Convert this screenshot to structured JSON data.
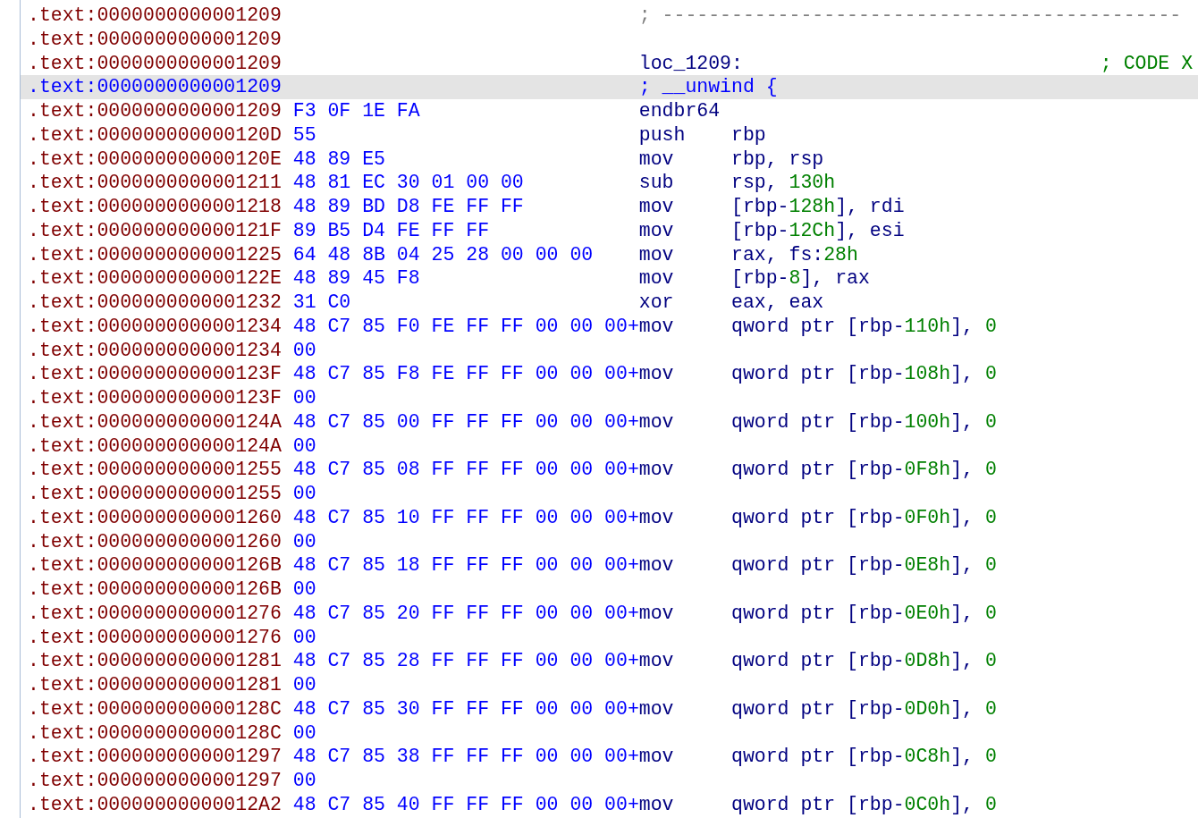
{
  "disassembly": {
    "lines": [
      {
        "kind": "separator",
        "selected": false,
        "address": ".text:0000000000001209",
        "text": "; ---------------------------------------------"
      },
      {
        "kind": "blank",
        "selected": false,
        "address": ".text:0000000000001209"
      },
      {
        "kind": "label",
        "selected": false,
        "address": ".text:0000000000001209",
        "label": "loc_1209:",
        "comment": "; CODE X"
      },
      {
        "kind": "directive",
        "selected": true,
        "address": ".text:0000000000001209",
        "text": "; __unwind {"
      },
      {
        "kind": "instruction",
        "selected": false,
        "address": ".text:0000000000001209",
        "bytes": "F3 0F 1E FA",
        "mnemonic": "endbr64"
      },
      {
        "kind": "instruction",
        "selected": false,
        "address": ".text:000000000000120D",
        "bytes": "55",
        "mnemonic": "push",
        "operands": [
          {
            "kind": "plain",
            "text": "rbp"
          }
        ]
      },
      {
        "kind": "instruction",
        "selected": false,
        "address": ".text:000000000000120E",
        "bytes": "48 89 E5",
        "mnemonic": "mov",
        "operands": [
          {
            "kind": "plain",
            "text": "rbp, rsp"
          }
        ]
      },
      {
        "kind": "instruction",
        "selected": false,
        "address": ".text:0000000000001211",
        "bytes": "48 81 EC 30 01 00 00",
        "mnemonic": "sub",
        "operands": [
          {
            "kind": "plain",
            "text": "rsp, "
          },
          {
            "kind": "number",
            "text": "130h"
          }
        ]
      },
      {
        "kind": "instruction",
        "selected": false,
        "address": ".text:0000000000001218",
        "bytes": "48 89 BD D8 FE FF FF",
        "mnemonic": "mov",
        "operands": [
          {
            "kind": "plain",
            "text": "[rbp-"
          },
          {
            "kind": "number",
            "text": "128h"
          },
          {
            "kind": "plain",
            "text": "], rdi"
          }
        ]
      },
      {
        "kind": "instruction",
        "selected": false,
        "address": ".text:000000000000121F",
        "bytes": "89 B5 D4 FE FF FF",
        "mnemonic": "mov",
        "operands": [
          {
            "kind": "plain",
            "text": "[rbp-"
          },
          {
            "kind": "number",
            "text": "12Ch"
          },
          {
            "kind": "plain",
            "text": "], esi"
          }
        ]
      },
      {
        "kind": "instruction",
        "selected": false,
        "address": ".text:0000000000001225",
        "bytes": "64 48 8B 04 25 28 00 00 00",
        "mnemonic": "mov",
        "operands": [
          {
            "kind": "plain",
            "text": "rax, fs:"
          },
          {
            "kind": "number",
            "text": "28h"
          }
        ]
      },
      {
        "kind": "instruction",
        "selected": false,
        "address": ".text:000000000000122E",
        "bytes": "48 89 45 F8",
        "mnemonic": "mov",
        "operands": [
          {
            "kind": "plain",
            "text": "[rbp-"
          },
          {
            "kind": "number",
            "text": "8"
          },
          {
            "kind": "plain",
            "text": "], rax"
          }
        ]
      },
      {
        "kind": "instruction",
        "selected": false,
        "address": ".text:0000000000001232",
        "bytes": "31 C0",
        "mnemonic": "xor",
        "operands": [
          {
            "kind": "plain",
            "text": "eax, eax"
          }
        ]
      },
      {
        "kind": "instruction",
        "selected": false,
        "address": ".text:0000000000001234",
        "bytes": "48 C7 85 F0 FE FF FF 00 00 00+",
        "mnemonic": "mov",
        "operands": [
          {
            "kind": "plain",
            "text": "qword ptr [rbp-"
          },
          {
            "kind": "number",
            "text": "110h"
          },
          {
            "kind": "plain",
            "text": "], "
          },
          {
            "kind": "number",
            "text": "0"
          }
        ]
      },
      {
        "kind": "bytes",
        "selected": false,
        "address": ".text:0000000000001234",
        "bytes": "00"
      },
      {
        "kind": "instruction",
        "selected": false,
        "address": ".text:000000000000123F",
        "bytes": "48 C7 85 F8 FE FF FF 00 00 00+",
        "mnemonic": "mov",
        "operands": [
          {
            "kind": "plain",
            "text": "qword ptr [rbp-"
          },
          {
            "kind": "number",
            "text": "108h"
          },
          {
            "kind": "plain",
            "text": "], "
          },
          {
            "kind": "number",
            "text": "0"
          }
        ]
      },
      {
        "kind": "bytes",
        "selected": false,
        "address": ".text:000000000000123F",
        "bytes": "00"
      },
      {
        "kind": "instruction",
        "selected": false,
        "address": ".text:000000000000124A",
        "bytes": "48 C7 85 00 FF FF FF 00 00 00+",
        "mnemonic": "mov",
        "operands": [
          {
            "kind": "plain",
            "text": "qword ptr [rbp-"
          },
          {
            "kind": "number",
            "text": "100h"
          },
          {
            "kind": "plain",
            "text": "], "
          },
          {
            "kind": "number",
            "text": "0"
          }
        ]
      },
      {
        "kind": "bytes",
        "selected": false,
        "address": ".text:000000000000124A",
        "bytes": "00"
      },
      {
        "kind": "instruction",
        "selected": false,
        "address": ".text:0000000000001255",
        "bytes": "48 C7 85 08 FF FF FF 00 00 00+",
        "mnemonic": "mov",
        "operands": [
          {
            "kind": "plain",
            "text": "qword ptr [rbp-"
          },
          {
            "kind": "number",
            "text": "0F8h"
          },
          {
            "kind": "plain",
            "text": "], "
          },
          {
            "kind": "number",
            "text": "0"
          }
        ]
      },
      {
        "kind": "bytes",
        "selected": false,
        "address": ".text:0000000000001255",
        "bytes": "00"
      },
      {
        "kind": "instruction",
        "selected": false,
        "address": ".text:0000000000001260",
        "bytes": "48 C7 85 10 FF FF FF 00 00 00+",
        "mnemonic": "mov",
        "operands": [
          {
            "kind": "plain",
            "text": "qword ptr [rbp-"
          },
          {
            "kind": "number",
            "text": "0F0h"
          },
          {
            "kind": "plain",
            "text": "], "
          },
          {
            "kind": "number",
            "text": "0"
          }
        ]
      },
      {
        "kind": "bytes",
        "selected": false,
        "address": ".text:0000000000001260",
        "bytes": "00"
      },
      {
        "kind": "instruction",
        "selected": false,
        "address": ".text:000000000000126B",
        "bytes": "48 C7 85 18 FF FF FF 00 00 00+",
        "mnemonic": "mov",
        "operands": [
          {
            "kind": "plain",
            "text": "qword ptr [rbp-"
          },
          {
            "kind": "number",
            "text": "0E8h"
          },
          {
            "kind": "plain",
            "text": "], "
          },
          {
            "kind": "number",
            "text": "0"
          }
        ]
      },
      {
        "kind": "bytes",
        "selected": false,
        "address": ".text:000000000000126B",
        "bytes": "00"
      },
      {
        "kind": "instruction",
        "selected": false,
        "address": ".text:0000000000001276",
        "bytes": "48 C7 85 20 FF FF FF 00 00 00+",
        "mnemonic": "mov",
        "operands": [
          {
            "kind": "plain",
            "text": "qword ptr [rbp-"
          },
          {
            "kind": "number",
            "text": "0E0h"
          },
          {
            "kind": "plain",
            "text": "], "
          },
          {
            "kind": "number",
            "text": "0"
          }
        ]
      },
      {
        "kind": "bytes",
        "selected": false,
        "address": ".text:0000000000001276",
        "bytes": "00"
      },
      {
        "kind": "instruction",
        "selected": false,
        "address": ".text:0000000000001281",
        "bytes": "48 C7 85 28 FF FF FF 00 00 00+",
        "mnemonic": "mov",
        "operands": [
          {
            "kind": "plain",
            "text": "qword ptr [rbp-"
          },
          {
            "kind": "number",
            "text": "0D8h"
          },
          {
            "kind": "plain",
            "text": "], "
          },
          {
            "kind": "number",
            "text": "0"
          }
        ]
      },
      {
        "kind": "bytes",
        "selected": false,
        "address": ".text:0000000000001281",
        "bytes": "00"
      },
      {
        "kind": "instruction",
        "selected": false,
        "address": ".text:000000000000128C",
        "bytes": "48 C7 85 30 FF FF FF 00 00 00+",
        "mnemonic": "mov",
        "operands": [
          {
            "kind": "plain",
            "text": "qword ptr [rbp-"
          },
          {
            "kind": "number",
            "text": "0D0h"
          },
          {
            "kind": "plain",
            "text": "], "
          },
          {
            "kind": "number",
            "text": "0"
          }
        ]
      },
      {
        "kind": "bytes",
        "selected": false,
        "address": ".text:000000000000128C",
        "bytes": "00"
      },
      {
        "kind": "instruction",
        "selected": false,
        "address": ".text:0000000000001297",
        "bytes": "48 C7 85 38 FF FF FF 00 00 00+",
        "mnemonic": "mov",
        "operands": [
          {
            "kind": "plain",
            "text": "qword ptr [rbp-"
          },
          {
            "kind": "number",
            "text": "0C8h"
          },
          {
            "kind": "plain",
            "text": "], "
          },
          {
            "kind": "number",
            "text": "0"
          }
        ]
      },
      {
        "kind": "bytes",
        "selected": false,
        "address": ".text:0000000000001297",
        "bytes": "00"
      },
      {
        "kind": "instruction",
        "selected": false,
        "address": ".text:00000000000012A2",
        "bytes": "48 C7 85 40 FF FF FF 00 00 00+",
        "mnemonic": "mov",
        "operands": [
          {
            "kind": "plain",
            "text": "qword ptr [rbp-"
          },
          {
            "kind": "number",
            "text": "0C0h"
          },
          {
            "kind": "plain",
            "text": "], "
          },
          {
            "kind": "number",
            "text": "0"
          }
        ]
      }
    ]
  }
}
